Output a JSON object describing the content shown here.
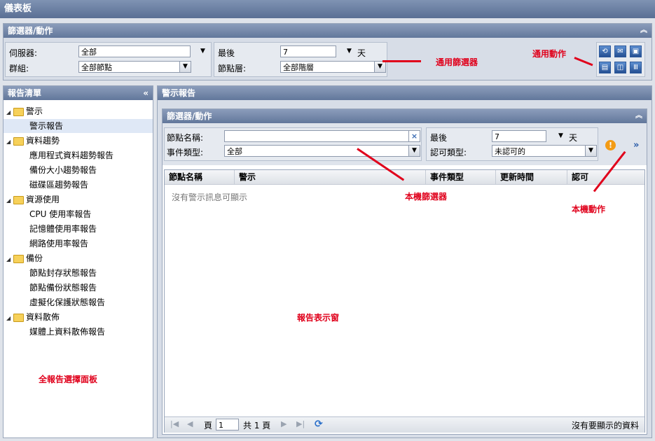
{
  "app": {
    "title": "儀表板"
  },
  "global_filter": {
    "header": "篩選器/動作",
    "server_label": "伺服器:",
    "server_value": "全部",
    "group_label": "群組:",
    "group_value": "全部節點",
    "last_label": "最後",
    "last_value": "7",
    "last_unit": "天",
    "node_layer_label": "節點層:",
    "node_layer_value": "全部階層"
  },
  "annotations": {
    "global_filter": "通用篩選器",
    "global_actions": "通用動作",
    "local_filter": "本機篩選器",
    "local_actions": "本機動作",
    "report_window": "報告表示窗",
    "report_panel": "全報告選擇面板"
  },
  "report_list": {
    "header": "報告清單",
    "tree": [
      {
        "label": "警示",
        "type": "folder"
      },
      {
        "label": "警示報告",
        "type": "leaf",
        "selected": true
      },
      {
        "label": "資料趨勢",
        "type": "folder"
      },
      {
        "label": "應用程式資料趨勢報告",
        "type": "leaf"
      },
      {
        "label": "備份大小趨勢報告",
        "type": "leaf"
      },
      {
        "label": "磁碟區趨勢報告",
        "type": "leaf"
      },
      {
        "label": "資源使用",
        "type": "folder"
      },
      {
        "label": "CPU 使用率報告",
        "type": "leaf"
      },
      {
        "label": "記憶體使用率報告",
        "type": "leaf"
      },
      {
        "label": "網路使用率報告",
        "type": "leaf"
      },
      {
        "label": "備份",
        "type": "folder"
      },
      {
        "label": "節點封存狀態報告",
        "type": "leaf"
      },
      {
        "label": "節點備份狀態報告",
        "type": "leaf"
      },
      {
        "label": "虛擬化保護狀態報告",
        "type": "leaf"
      },
      {
        "label": "資料散佈",
        "type": "folder"
      },
      {
        "label": "媒體上資料散佈報告",
        "type": "leaf"
      }
    ]
  },
  "alert_report": {
    "header": "警示報告",
    "filter_header": "篩選器/動作",
    "node_name_label": "節點名稱:",
    "node_name_value": "",
    "event_type_label": "事件類型:",
    "event_type_value": "全部",
    "last_label": "最後",
    "last_value": "7",
    "last_unit": "天",
    "ack_type_label": "認可類型:",
    "ack_type_value": "未認可的",
    "columns": [
      "節點名稱",
      "警示",
      "事件類型",
      "更新時間",
      "認可"
    ],
    "empty_message": "沒有警示訊息可顯示",
    "pager": {
      "page_label": "頁",
      "page_value": "1",
      "total_label": "共 1 頁",
      "status": "沒有要顯示的資料"
    }
  },
  "colors": {
    "annotation": "#e0001b",
    "header_blue": "#62779b"
  }
}
